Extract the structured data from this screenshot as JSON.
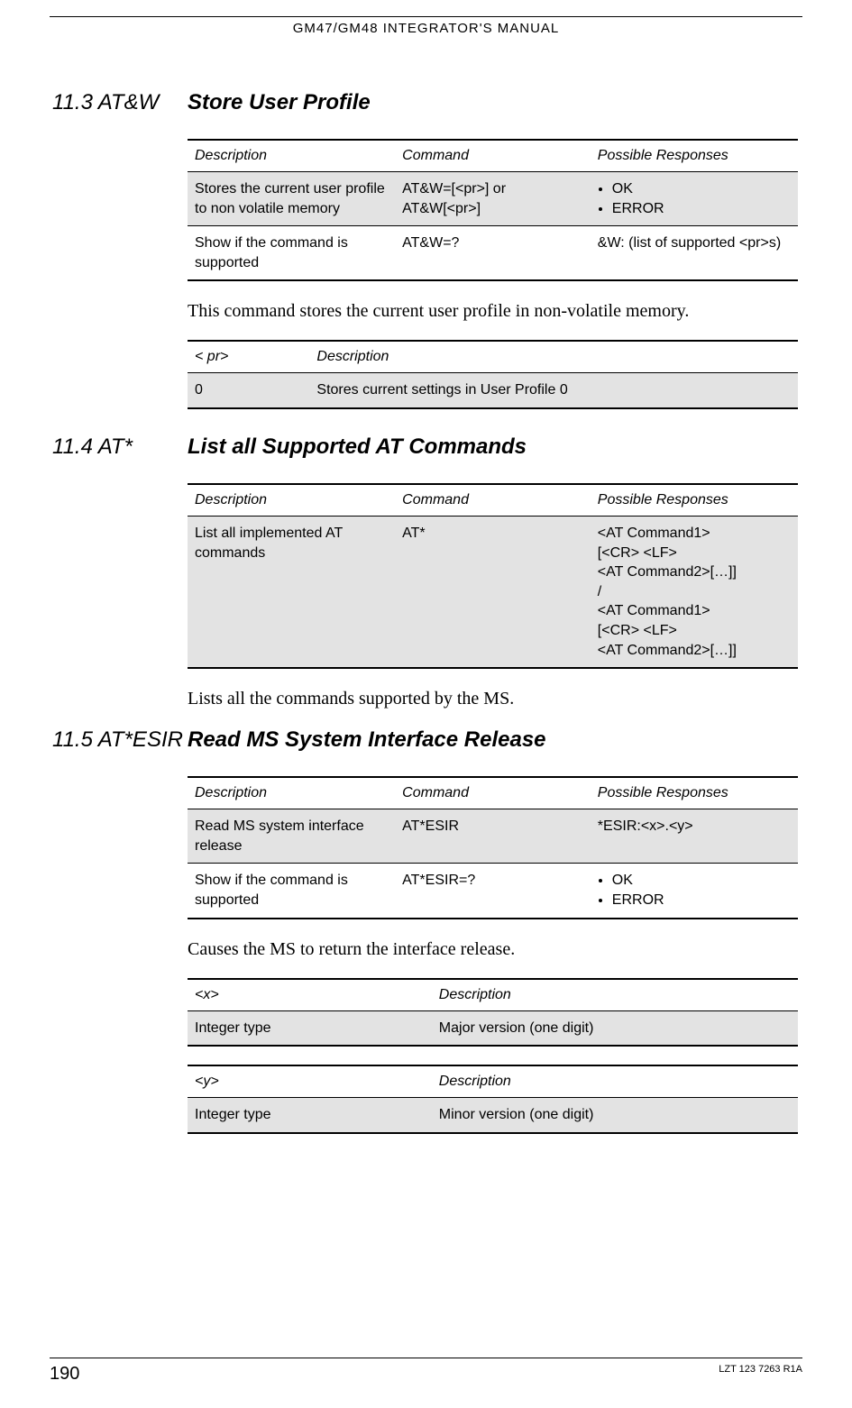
{
  "header": "GM47/GM48 INTEGRATOR'S MANUAL",
  "sections": {
    "s1": {
      "num": "11.3 AT&W",
      "title": "Store User Profile"
    },
    "s2": {
      "num": "11.4 AT*",
      "title": "List all Supported AT Commands"
    },
    "s3": {
      "num": "11.5 AT*ESIR",
      "title": "Read MS System Interface Release"
    }
  },
  "th": {
    "desc": "Description",
    "cmd": "Command",
    "resp": "Possible Responses"
  },
  "t1": {
    "r1": {
      "desc": "Stores the current user profile to non volatile memory",
      "cmd": "AT&W=[<pr>] or AT&W[<pr>]",
      "resp1": "OK",
      "resp2": "ERROR"
    },
    "r2": {
      "desc": "Show if the command is supported",
      "cmd": "AT&W=?",
      "resp": "&W: (list of supported <pr>s)"
    }
  },
  "body1": "This command stores the current user profile in non-volatile memory.",
  "t1p": {
    "h1": "< pr>",
    "h2": "Description",
    "r1c1": "0",
    "r1c2": "Stores current settings in User Profile 0"
  },
  "t2": {
    "r1": {
      "desc": "List all implemented AT commands",
      "cmd": "AT*",
      "respL1": "<AT Command1>",
      "respL2": "[<CR> <LF>",
      "respL3": "<AT Command2>[…]]",
      "respL4": "/",
      "respL5": "<AT Command1>",
      "respL6": "[<CR> <LF>",
      "respL7": "<AT Command2>[…]]"
    }
  },
  "body2": "Lists all the commands supported by the MS.",
  "t3": {
    "r1": {
      "desc": "Read MS system interface release",
      "cmd": "AT*ESIR",
      "resp": "*ESIR:<x>.<y>"
    },
    "r2": {
      "desc": "Show if the command is supported",
      "cmd": "AT*ESIR=?",
      "resp1": "OK",
      "resp2": "ERROR"
    }
  },
  "body3": "Causes the MS to return the interface release.",
  "t3x": {
    "h1": "<x>",
    "h2": "Description",
    "r1c1": "Integer type",
    "r1c2": "Major version (one digit)"
  },
  "t3y": {
    "h1": "<y>",
    "h2": "Description",
    "r1c1": "Integer type",
    "r1c2": "Minor version (one digit)"
  },
  "footer": {
    "page": "190",
    "doc": "LZT 123 7263 R1A"
  }
}
